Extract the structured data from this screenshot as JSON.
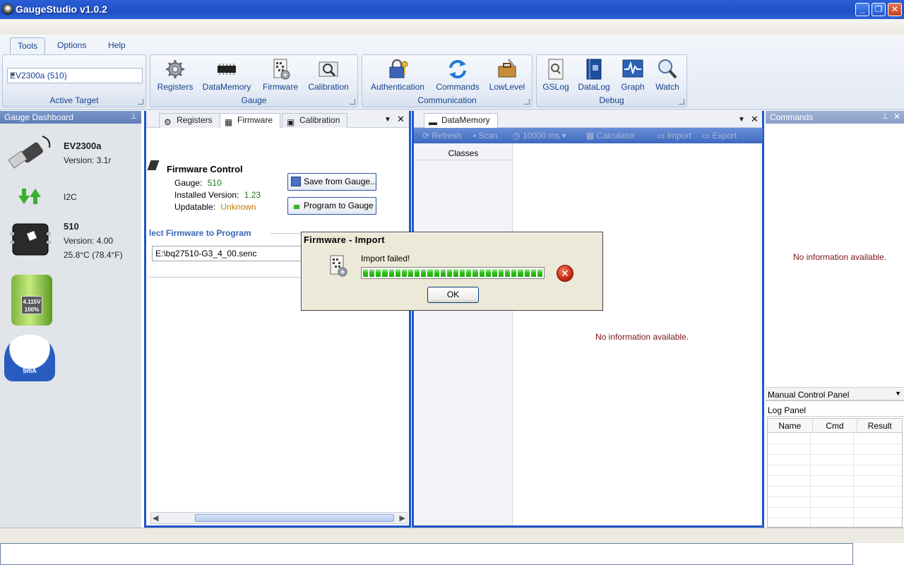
{
  "window": {
    "title": "GaugeStudio v1.0.2",
    "min": "_",
    "restore": "❐",
    "close": "✕"
  },
  "ribbon": {
    "tabs": [
      "Tools",
      "Options",
      "Help"
    ],
    "active_target": {
      "value": "EV2300a (510)",
      "label": "Active Target"
    },
    "gauge_group": {
      "label": "Gauge",
      "buttons": [
        "Registers",
        "DataMemory",
        "Firmware",
        "Calibration"
      ]
    },
    "comm_group": {
      "label": "Communication",
      "buttons": [
        "Authentication",
        "Commands",
        "LowLevel"
      ]
    },
    "debug_group": {
      "label": "Debug",
      "buttons": [
        "GSLog",
        "DataLog",
        "Graph",
        "Watch"
      ]
    }
  },
  "dashboard": {
    "title": "Gauge Dashboard",
    "device_name": "EV2300a",
    "device_version": "Version: 3.1r",
    "bus": "I2C",
    "gauge_name": "510",
    "gauge_version": "Version: 4.00",
    "temperature": "25.8°C (78.4°F)",
    "battery_voltage": "4.115V",
    "battery_percent": "100%",
    "current": "5mA"
  },
  "left_doc": {
    "tabs": [
      "Registers",
      "Firmware",
      "Calibration"
    ],
    "firmware": {
      "heading": "Firmware Control",
      "gauge_label": "Gauge:",
      "gauge_value": "510",
      "installed_label": "Installed Version:",
      "installed_value": "1.23",
      "updatable_label": "Updatable:",
      "updatable_value": "Unknown",
      "save_button": "Save from Gauge...",
      "program_button": "Program to Gauge",
      "select_heading": "lect Firmware to Program",
      "file_path": "E:\\bq27510-G3_4_00.senc"
    }
  },
  "right_doc": {
    "tab": "DataMemory",
    "toolbar": [
      "Refresh",
      "Scan",
      "10000 ms",
      "Calculator",
      "Import",
      "Export"
    ],
    "classes_header": "Classes",
    "empty": "No information available."
  },
  "commands_panel": {
    "title": "Commands",
    "empty": "No information available.",
    "manual_control": "Manual Control Panel",
    "log_panel": "Log Panel",
    "log_columns": [
      "Name",
      "Cmd",
      "Result"
    ]
  },
  "dialog": {
    "title": "Firmware - Import",
    "message": "Import failed!",
    "progress": 1.0,
    "ok_button": "OK"
  }
}
